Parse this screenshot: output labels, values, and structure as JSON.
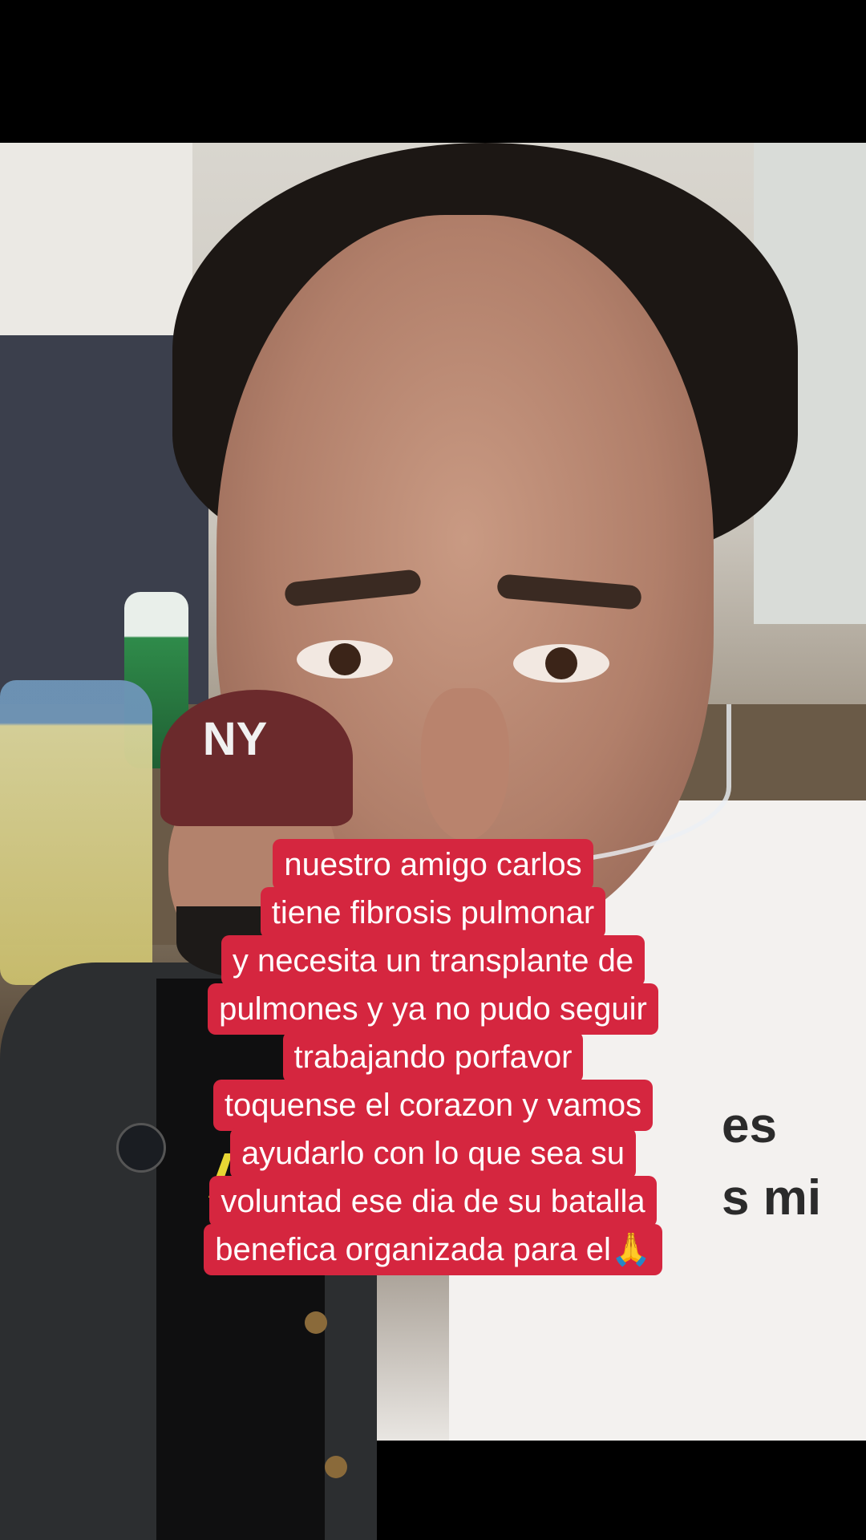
{
  "caption": {
    "lines": [
      "nuestro amigo carlos",
      "tiene fibrosis pulmonar",
      "y necesita un transplante de",
      "pulmones y ya no pudo seguir",
      "trabajando porfavor",
      "toquense el corazon y vamos",
      "ayudarlo con lo que sea su",
      "voluntad ese dia de su batalla",
      "benefica organizada para el🙏"
    ]
  },
  "background_text": {
    "line1": "es",
    "line2": "s mi"
  },
  "overlay": {
    "cap_logo": "NY",
    "shirt_text": "A:"
  },
  "colors": {
    "caption_bg": "#d5263f",
    "caption_text": "#ffffff",
    "letterbox": "#000000"
  }
}
